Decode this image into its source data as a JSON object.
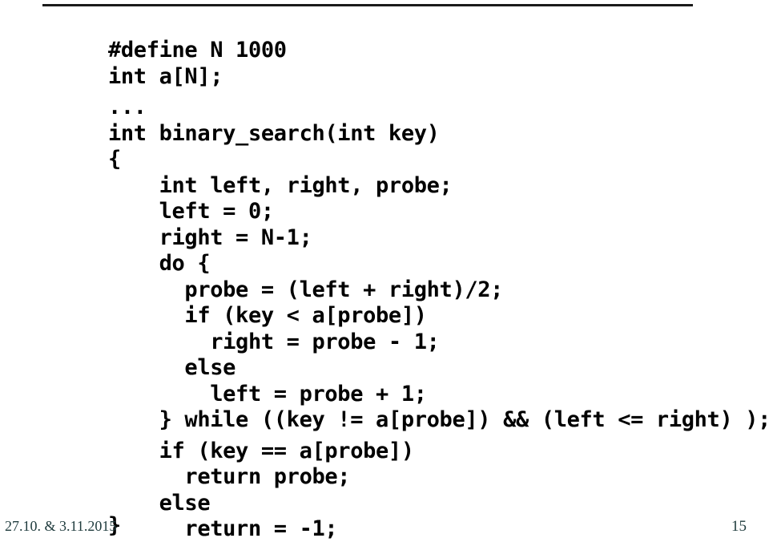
{
  "slide": {
    "page_number": "15",
    "footer_date": "27.10. & 3.11.2015",
    "colors": {
      "background": "#ffffff",
      "code_text": "#000000",
      "rule": "#1a1a1a",
      "footer_text": "#1f3b3d"
    }
  },
  "code": {
    "language": "c",
    "lines": [
      "#define N 1000",
      "int a[N];",
      "",
      "...",
      "int binary_search(int key)",
      "{",
      "    int left, right, probe;",
      "    left = 0;",
      "    right = N-1;",
      "    do {",
      "      probe = (left + right)/2;",
      "      if (key < a[probe])",
      "        right = probe - 1;",
      "      else",
      "        left = probe + 1;",
      "    } while ((key != a[probe]) && (left <= right) );",
      "",
      "    if (key == a[probe])",
      "      return probe;",
      "    else",
      "      return = -1;"
    ],
    "closing_brace": "}"
  }
}
